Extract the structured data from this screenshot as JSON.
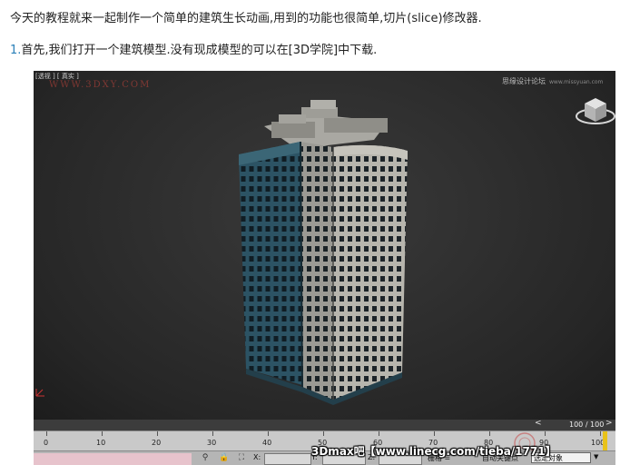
{
  "article": {
    "para1": "今天的教程就来一起制作一个简单的建筑生长动画,用到的功能也很简单,切片(slice)修改器.",
    "para2_num": "1.",
    "para2_text": "首先,我们打开一个建筑模型.没有现成模型的可以在[3D学院]中下载."
  },
  "viewport": {
    "label": "[透视 ] [ 真实 ]",
    "watermark_site": "WWW.3DXY.COM",
    "watermark_forum": "思缘设计论坛",
    "watermark_forum_url": "www.missyuan.com",
    "viewcube_icon": "viewcube-icon",
    "axis_icon": "axis-tripod-icon"
  },
  "timeline": {
    "frame_counter": "100 / 100",
    "prev_arrow": "<",
    "next_arrow": ">",
    "ticks": [
      "0",
      "10",
      "20",
      "30",
      "40",
      "50",
      "60",
      "70",
      "80",
      "90",
      "100"
    ]
  },
  "statusbar": {
    "x_label": "X:",
    "y_label": "Y:",
    "z_label": "Z:",
    "grid_label": "栅格 =",
    "auto_key": "自动关键点",
    "selection_value": "选定对象"
  },
  "overlay": {
    "caption": "3Dmax吧【www.linecg.com/tieba/1771】"
  },
  "colors": {
    "timeline_end_marker": "#e8c21a",
    "status_pink": "#e7c3cc",
    "link_blue": "#2a7fb8"
  }
}
